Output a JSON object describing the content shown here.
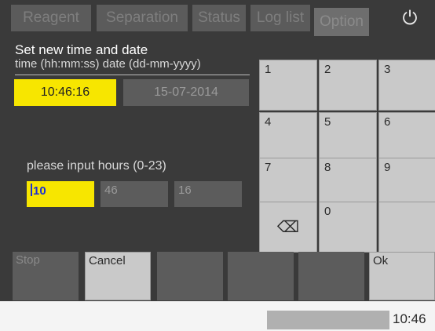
{
  "tabs": [
    {
      "label": "Reagent"
    },
    {
      "label": "Separation"
    },
    {
      "label": "Status"
    },
    {
      "label": "Log list"
    },
    {
      "label": "Option"
    }
  ],
  "power_icon": "⏻",
  "form": {
    "title": "Set new time and date",
    "subhead": "time (hh:mm:ss) date (dd-mm-yyyy)",
    "time_value": "10:46:16",
    "date_value": "15-07-2014",
    "prompt": "please input hours (0-23)",
    "hours": "10",
    "minutes": "46",
    "seconds": "16"
  },
  "keypad": {
    "k1": "1",
    "k2": "2",
    "k3": "3",
    "k4": "4",
    "k5": "5",
    "k6": "6",
    "k7": "7",
    "k8": "8",
    "k9": "9",
    "k0": "0",
    "backspace_icon": "⌫"
  },
  "bottom": {
    "stop": "Stop",
    "cancel": "Cancel",
    "ok": "Ok"
  },
  "status": {
    "clock": "10:46"
  }
}
